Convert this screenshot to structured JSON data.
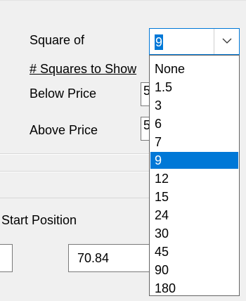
{
  "labels": {
    "square_of": "Square of",
    "squares_to_show": "# Squares to Show",
    "below_price": "Below Price",
    "above_price": "Above Price",
    "start_position": "Start Position"
  },
  "fields": {
    "below_price_value": "5",
    "above_price_value": "5",
    "start_position_value": "70.84"
  },
  "square_of_combo": {
    "selected": "9",
    "options": [
      "None",
      "1.5",
      "3",
      "6",
      "7",
      "9",
      "12",
      "15",
      "24",
      "30",
      "45",
      "90",
      "180"
    ]
  }
}
